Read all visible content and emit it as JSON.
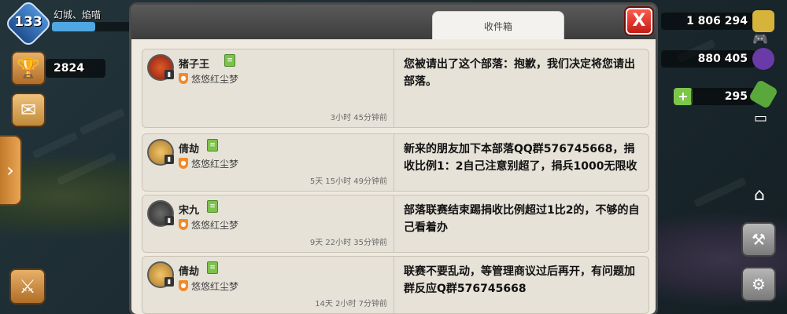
{
  "hud": {
    "level": "133",
    "player_name": "幻城、焰喵",
    "trophies": "2824",
    "gold": "1 806 294",
    "elixir": "880 405",
    "gems": "295"
  },
  "mailbox": {
    "tab_label": "收件箱",
    "close_label": "X",
    "messages": [
      {
        "sender": "猪子王",
        "clan": "悠悠红尘梦",
        "time": "3小时 45分钟前",
        "text": "您被请出了这个部落：抱歉，我们决定将您请出部落。"
      },
      {
        "sender": "倩劫",
        "clan": "悠悠红尘梦",
        "time": "5天 15小时 49分钟前",
        "text": "新来的朋友加下本部落QQ群576745668，捐收比例1：2自己注意别超了，捐兵1000无限收"
      },
      {
        "sender": "宋九",
        "clan": "悠悠红尘梦",
        "time": "9天 22小时 35分钟前",
        "text": "部落联赛结束踢捐收比例超过1比2的，不够的自己看着办"
      },
      {
        "sender": "倩劫",
        "clan": "悠悠红尘梦",
        "time": "14天 2小时 7分钟前",
        "text": "联赛不要乱动，等管理商议过后再开，有问题加群反应Q群576745668"
      }
    ]
  },
  "colors": {
    "accent_close": "#d42a1f",
    "doc_icon": "#7dc24b",
    "gem_green": "#5aa83b"
  }
}
